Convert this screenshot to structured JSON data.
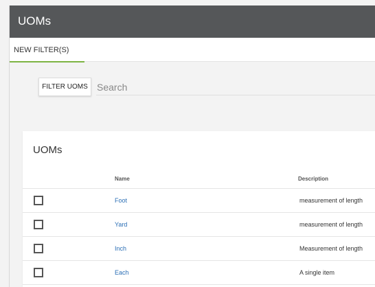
{
  "header": {
    "title": "UOMs"
  },
  "tabs": [
    {
      "label": "NEW FILTER(S)",
      "active": true
    }
  ],
  "filter": {
    "button_label": "FILTER UOMS",
    "search_placeholder": "Search",
    "search_value": ""
  },
  "card": {
    "title": "UOMs",
    "columns": {
      "name": "Name",
      "description": "Description"
    },
    "rows": [
      {
        "name": "Foot",
        "description": "measurement of length",
        "checked": false
      },
      {
        "name": "Yard",
        "description": "measurement of length",
        "checked": false
      },
      {
        "name": "Inch",
        "description": "Measurement of length",
        "checked": false
      },
      {
        "name": "Each",
        "description": "A single item",
        "checked": false
      }
    ]
  },
  "colors": {
    "header_bg": "#555759",
    "accent": "#7cb342",
    "link": "#2a6eb5"
  }
}
